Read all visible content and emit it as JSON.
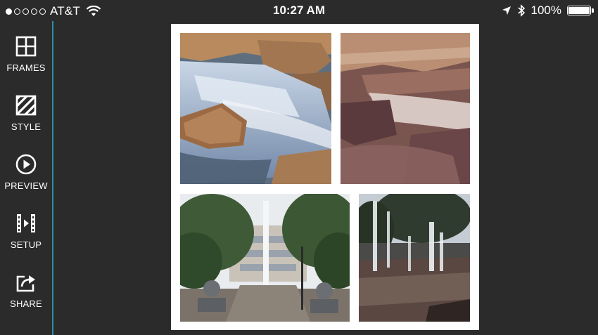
{
  "status_bar": {
    "carrier": "AT&T",
    "time": "10:27 AM",
    "battery_percent": "100%",
    "battery_level": 1.0,
    "signal_bars_filled": 1,
    "signal_bars_total": 5,
    "icons": [
      "wifi-icon",
      "location-arrow-icon",
      "bluetooth-icon",
      "battery-icon"
    ]
  },
  "sidebar": {
    "accent_color": "#2e8fa8",
    "items": [
      {
        "label": "FRAMES",
        "icon": "frames-grid-icon"
      },
      {
        "label": "STYLE",
        "icon": "style-stripes-icon"
      },
      {
        "label": "PREVIEW",
        "icon": "play-circle-icon"
      },
      {
        "label": "SETUP",
        "icon": "film-strip-icon"
      },
      {
        "label": "SHARE",
        "icon": "share-arrow-icon"
      }
    ]
  },
  "collage": {
    "background": "#ffffff",
    "photos": [
      {
        "subject": "waterfall-over-rocks"
      },
      {
        "subject": "sepia-cascading-water"
      },
      {
        "subject": "plaza-with-trees"
      },
      {
        "subject": "splash-fountain-jets"
      }
    ]
  }
}
